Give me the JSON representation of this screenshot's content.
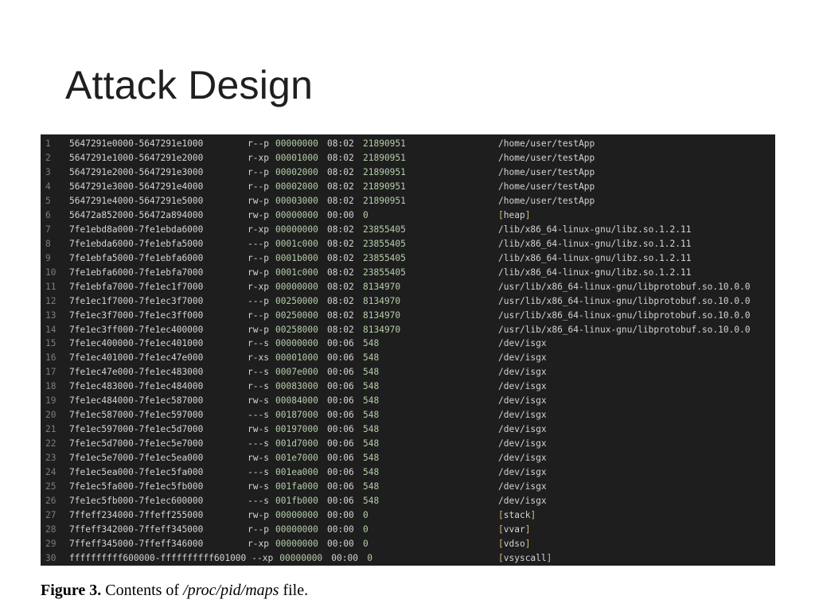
{
  "slide": {
    "title": "Attack Design"
  },
  "terminal": {
    "lines": [
      {
        "num": "1",
        "range": "5647291e0000-5647291e1000",
        "perms": "r--p",
        "offset": "00000000",
        "dev": "08:02",
        "inode": "21890951",
        "path": "/home/user/testApp"
      },
      {
        "num": "2",
        "range": "5647291e1000-5647291e2000",
        "perms": "r-xp",
        "offset": "00001000",
        "dev": "08:02",
        "inode": "21890951",
        "path": "/home/user/testApp"
      },
      {
        "num": "3",
        "range": "5647291e2000-5647291e3000",
        "perms": "r--p",
        "offset": "00002000",
        "dev": "08:02",
        "inode": "21890951",
        "path": "/home/user/testApp"
      },
      {
        "num": "4",
        "range": "5647291e3000-5647291e4000",
        "perms": "r--p",
        "offset": "00002000",
        "dev": "08:02",
        "inode": "21890951",
        "path": "/home/user/testApp"
      },
      {
        "num": "5",
        "range": "5647291e4000-5647291e5000",
        "perms": "rw-p",
        "offset": "00003000",
        "dev": "08:02",
        "inode": "21890951",
        "path": "/home/user/testApp"
      },
      {
        "num": "6",
        "range": "56472a852000-56472a894000",
        "perms": "rw-p",
        "offset": "00000000",
        "dev": "00:00",
        "inode": "0",
        "path": "heap",
        "bracketed": true
      },
      {
        "num": "7",
        "range": "7fe1ebd8a000-7fe1ebda6000",
        "perms": "r-xp",
        "offset": "00000000",
        "dev": "08:02",
        "inode": "23855405",
        "path": "/lib/x86_64-linux-gnu/libz.so.1.2.11"
      },
      {
        "num": "8",
        "range": "7fe1ebda6000-7fe1ebfa5000",
        "perms": "---p",
        "offset": "0001c000",
        "dev": "08:02",
        "inode": "23855405",
        "path": "/lib/x86_64-linux-gnu/libz.so.1.2.11"
      },
      {
        "num": "9",
        "range": "7fe1ebfa5000-7fe1ebfa6000",
        "perms": "r--p",
        "offset": "0001b000",
        "dev": "08:02",
        "inode": "23855405",
        "path": "/lib/x86_64-linux-gnu/libz.so.1.2.11"
      },
      {
        "num": "10",
        "range": "7fe1ebfa6000-7fe1ebfa7000",
        "perms": "rw-p",
        "offset": "0001c000",
        "dev": "08:02",
        "inode": "23855405",
        "path": "/lib/x86_64-linux-gnu/libz.so.1.2.11"
      },
      {
        "num": "11",
        "range": "7fe1ebfa7000-7fe1ec1f7000",
        "perms": "r-xp",
        "offset": "00000000",
        "dev": "08:02",
        "inode": "8134970",
        "path": "/usr/lib/x86_64-linux-gnu/libprotobuf.so.10.0.0"
      },
      {
        "num": "12",
        "range": "7fe1ec1f7000-7fe1ec3f7000",
        "perms": "---p",
        "offset": "00250000",
        "dev": "08:02",
        "inode": "8134970",
        "path": "/usr/lib/x86_64-linux-gnu/libprotobuf.so.10.0.0"
      },
      {
        "num": "13",
        "range": "7fe1ec3f7000-7fe1ec3ff000",
        "perms": "r--p",
        "offset": "00250000",
        "dev": "08:02",
        "inode": "8134970",
        "path": "/usr/lib/x86_64-linux-gnu/libprotobuf.so.10.0.0"
      },
      {
        "num": "14",
        "range": "7fe1ec3ff000-7fe1ec400000",
        "perms": "rw-p",
        "offset": "00258000",
        "dev": "08:02",
        "inode": "8134970",
        "path": "/usr/lib/x86_64-linux-gnu/libprotobuf.so.10.0.0"
      },
      {
        "num": "15",
        "range": "7fe1ec400000-7fe1ec401000",
        "perms": "r--s",
        "offset": "00000000",
        "dev": "00:06",
        "inode": "548",
        "path": "/dev/isgx"
      },
      {
        "num": "16",
        "range": "7fe1ec401000-7fe1ec47e000",
        "perms": "r-xs",
        "offset": "00001000",
        "dev": "00:06",
        "inode": "548",
        "path": "/dev/isgx"
      },
      {
        "num": "17",
        "range": "7fe1ec47e000-7fe1ec483000",
        "perms": "r--s",
        "offset": "0007e000",
        "dev": "00:06",
        "inode": "548",
        "path": "/dev/isgx"
      },
      {
        "num": "18",
        "range": "7fe1ec483000-7fe1ec484000",
        "perms": "r--s",
        "offset": "00083000",
        "dev": "00:06",
        "inode": "548",
        "path": "/dev/isgx"
      },
      {
        "num": "19",
        "range": "7fe1ec484000-7fe1ec587000",
        "perms": "rw-s",
        "offset": "00084000",
        "dev": "00:06",
        "inode": "548",
        "path": "/dev/isgx"
      },
      {
        "num": "20",
        "range": "7fe1ec587000-7fe1ec597000",
        "perms": "---s",
        "offset": "00187000",
        "dev": "00:06",
        "inode": "548",
        "path": "/dev/isgx"
      },
      {
        "num": "21",
        "range": "7fe1ec597000-7fe1ec5d7000",
        "perms": "rw-s",
        "offset": "00197000",
        "dev": "00:06",
        "inode": "548",
        "path": "/dev/isgx"
      },
      {
        "num": "22",
        "range": "7fe1ec5d7000-7fe1ec5e7000",
        "perms": "---s",
        "offset": "001d7000",
        "dev": "00:06",
        "inode": "548",
        "path": "/dev/isgx"
      },
      {
        "num": "23",
        "range": "7fe1ec5e7000-7fe1ec5ea000",
        "perms": "rw-s",
        "offset": "001e7000",
        "dev": "00:06",
        "inode": "548",
        "path": "/dev/isgx"
      },
      {
        "num": "24",
        "range": "7fe1ec5ea000-7fe1ec5fa000",
        "perms": "---s",
        "offset": "001ea000",
        "dev": "00:06",
        "inode": "548",
        "path": "/dev/isgx"
      },
      {
        "num": "25",
        "range": "7fe1ec5fa000-7fe1ec5fb000",
        "perms": "rw-s",
        "offset": "001fa000",
        "dev": "00:06",
        "inode": "548",
        "path": "/dev/isgx"
      },
      {
        "num": "26",
        "range": "7fe1ec5fb000-7fe1ec600000",
        "perms": "---s",
        "offset": "001fb000",
        "dev": "00:06",
        "inode": "548",
        "path": "/dev/isgx"
      },
      {
        "num": "27",
        "range": "7ffeff234000-7ffeff255000",
        "perms": "rw-p",
        "offset": "00000000",
        "dev": "00:00",
        "inode": "0",
        "path": "stack",
        "bracketed": true
      },
      {
        "num": "28",
        "range": "7ffeff342000-7ffeff345000",
        "perms": "r--p",
        "offset": "00000000",
        "dev": "00:00",
        "inode": "0",
        "path": "vvar",
        "bracketed": true
      },
      {
        "num": "29",
        "range": "7ffeff345000-7ffeff346000",
        "perms": "r-xp",
        "offset": "00000000",
        "dev": "00:00",
        "inode": "0",
        "path": "vdso",
        "bracketed": true
      },
      {
        "num": "30",
        "range": "ffffffffff600000-ffffffffff601000",
        "perms": "--xp",
        "offset": "00000000",
        "dev": "00:00",
        "inode": "0",
        "path": "vsyscall",
        "bracketed": true,
        "wide": true
      }
    ]
  },
  "caption": {
    "label": "Figure 3.",
    "text_before": " Contents of ",
    "path": "/proc/pid/maps",
    "text_after": " file."
  },
  "colors": {
    "terminal_bg": "#1e1e1e",
    "text": "#d4d4d4",
    "number": "#b5cea8",
    "bracket": "#d7ba7d",
    "line_number": "#7d7d7d"
  }
}
